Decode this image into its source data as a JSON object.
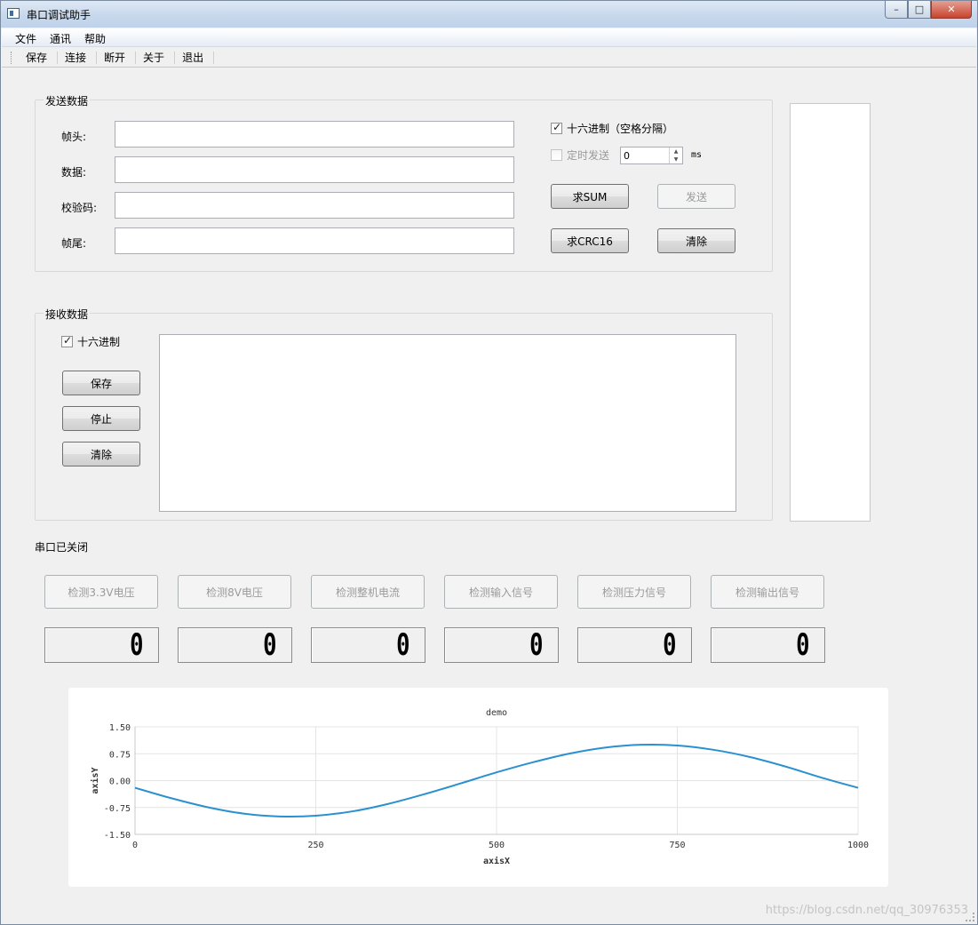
{
  "window": {
    "title": "串口调试助手",
    "controls": {
      "minimize": "–",
      "maximize": "□",
      "close": "✕"
    }
  },
  "menubar": [
    "文件",
    "通讯",
    "帮助"
  ],
  "toolbar": [
    "保存",
    "连接",
    "断开",
    "关于",
    "退出"
  ],
  "send": {
    "title": "发送数据",
    "fields": [
      {
        "label": "帧头:",
        "value": ""
      },
      {
        "label": "数据:",
        "value": ""
      },
      {
        "label": "校验码:",
        "value": ""
      },
      {
        "label": "帧尾:",
        "value": ""
      }
    ],
    "hex_checkbox": {
      "label": "十六进制（空格分隔）",
      "checked": true
    },
    "timer_checkbox": {
      "label": "定时发送",
      "checked": false
    },
    "timer_value": "0",
    "timer_unit": "ms",
    "buttons": {
      "sum": "求SUM",
      "send": "发送",
      "crc16": "求CRC16",
      "clear": "清除"
    }
  },
  "receive": {
    "title": "接收数据",
    "hex_checkbox": {
      "label": "十六进制",
      "checked": true
    },
    "buttons": {
      "save": "保存",
      "stop": "停止",
      "clear": "清除"
    },
    "content": ""
  },
  "status": "串口已关闭",
  "detect_buttons": [
    "检测3.3V电压",
    "检测8V电压",
    "检测整机电流",
    "检测输入信号",
    "检测压力信号",
    "检测输出信号"
  ],
  "lcd_values": [
    "0",
    "0",
    "0",
    "0",
    "0",
    "0"
  ],
  "chart_data": {
    "type": "line",
    "title": "demo",
    "xlabel": "axisX",
    "ylabel": "axisY",
    "xlim": [
      0,
      1000
    ],
    "ylim": [
      -1.5,
      1.5
    ],
    "x_ticks": [
      "0",
      "250",
      "500",
      "750",
      "1000"
    ],
    "y_ticks": [
      "1.50",
      "0.75",
      "0.00",
      "-0.75",
      "-1.50"
    ],
    "grid": true,
    "series": [
      {
        "color": "#2a90d0",
        "x": [
          0,
          50,
          100,
          150,
          200,
          250,
          300,
          350,
          400,
          450,
          500,
          550,
          600,
          650,
          700,
          750,
          800,
          850,
          900,
          950,
          1000
        ],
        "y": [
          -0.2,
          -0.49,
          -0.74,
          -0.92,
          -1.0,
          -0.98,
          -0.86,
          -0.65,
          -0.38,
          -0.08,
          0.23,
          0.51,
          0.75,
          0.92,
          1.0,
          0.98,
          0.86,
          0.66,
          0.39,
          0.08,
          -0.2
        ]
      }
    ]
  },
  "watermark": "https://blog.csdn.net/qq_30976353"
}
